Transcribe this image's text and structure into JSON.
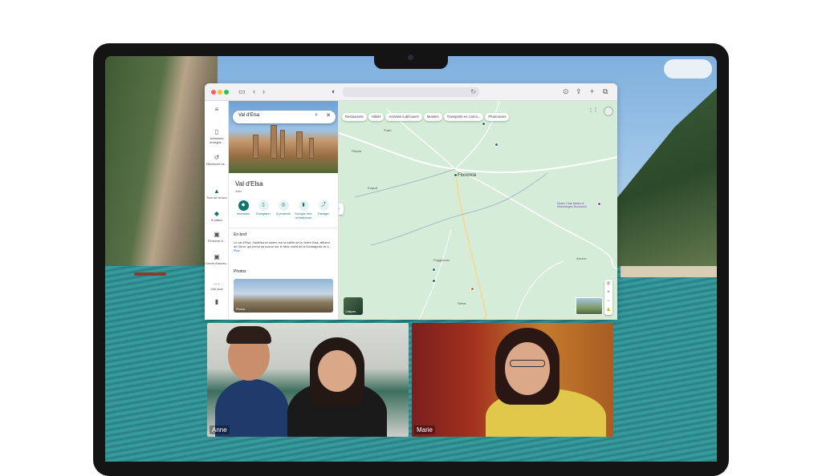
{
  "map_panel": {
    "search_value": "Val d'Elsa",
    "place_title": "Val d'Elsa",
    "place_subtitle": "Italie",
    "actions": [
      {
        "label": "Itinéraires"
      },
      {
        "label": "Enregistrer"
      },
      {
        "label": "À proximité"
      },
      {
        "label": "Envoyer vers un téléphone"
      },
      {
        "label": "Partager"
      }
    ],
    "brief_heading": "En bref",
    "brief_text": "Le val d'Elsa, Valdelsa en italien, est la vallée de la rivière Elsa, affluent de l'Arno, qui prend sa source sur le flanc ouest de la Montagnola de il...",
    "brief_more": "Plus",
    "photos_heading": "Photos",
    "photo_label": "Photos"
  },
  "rail": [
    {
      "icon": "menu-icon",
      "label": ""
    },
    {
      "icon": "bookmark-icon",
      "label": "Adresses enregist..."
    },
    {
      "icon": "history-icon",
      "label": "Recherch es..."
    },
    {
      "icon": "tour-icon",
      "label": "Tour de la tour"
    },
    {
      "icon": "pin-icon",
      "label": "À visiter"
    },
    {
      "icon": "photo-icon",
      "label": "Florence li..."
    },
    {
      "icon": "photo-icon",
      "label": "Comm d'acces..."
    },
    {
      "icon": "more-icon",
      "label": "Voir plus"
    },
    {
      "icon": "phone-icon",
      "label": ""
    }
  ],
  "map_chips": [
    "Restaurants",
    "Hôtels",
    "Activités à découvrir",
    "Musées",
    "Transports en comm...",
    "Pharmacies"
  ],
  "map_labels": [
    {
      "text": "Prato"
    },
    {
      "text": "Florence"
    },
    {
      "text": "Poggibonsi"
    },
    {
      "text": "Siena"
    },
    {
      "text": "Empoli"
    },
    {
      "text": "Arezzo"
    },
    {
      "text": "Pistoia"
    },
    {
      "text": "Museo Casa Natale di Michelangelo Buonarroti"
    }
  ],
  "map_layers_label": "Calques",
  "participants": [
    {
      "name": "Anne"
    },
    {
      "name": "Marie"
    }
  ],
  "colors": {
    "accent": "#0f766e",
    "map_bg": "#d4ecd8"
  }
}
